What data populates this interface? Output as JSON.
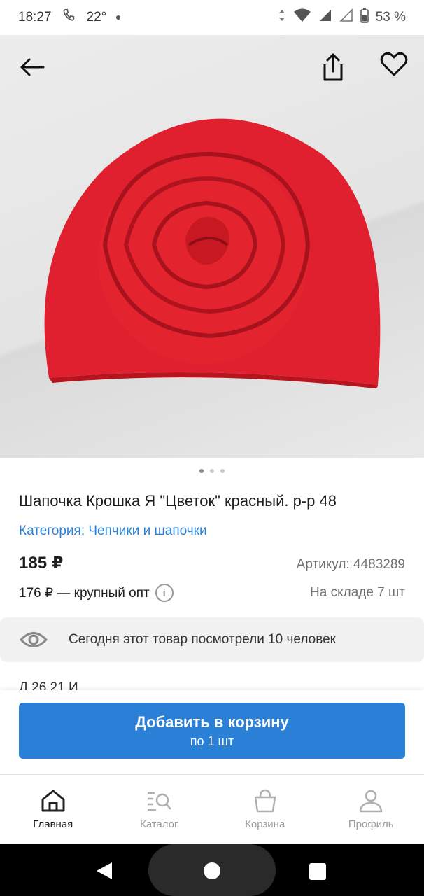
{
  "status_bar": {
    "time": "18:27",
    "temp": "22°",
    "battery": "53 %"
  },
  "product": {
    "title": "Шапочка Крошка Я \"Цветок\" красный. р-р 48",
    "category": "Категория: Чепчики и шапочки",
    "price": "185 ₽",
    "sku": "Артикул: 4483289",
    "wholesale": "176 ₽ — крупный опт",
    "stock": "На складе 7 шт",
    "image_count": 3,
    "active_image": 1
  },
  "views_notice": "Сегодня этот товар посмотрели 10 человек",
  "cutoff_text": "Д 26 21 И",
  "cta": {
    "label": "Добавить в корзину",
    "sub": "по 1 шт",
    "color": "#2a7fd6"
  },
  "nav": {
    "items": [
      {
        "label": "Главная",
        "icon": "home-icon",
        "active": true
      },
      {
        "label": "Каталог",
        "icon": "catalog-search-icon",
        "active": false
      },
      {
        "label": "Корзина",
        "icon": "cart-bag-icon",
        "active": false
      },
      {
        "label": "Профиль",
        "icon": "profile-icon",
        "active": false
      }
    ]
  },
  "colors": {
    "accent": "#2a7fd6",
    "product": "#e0202e"
  }
}
